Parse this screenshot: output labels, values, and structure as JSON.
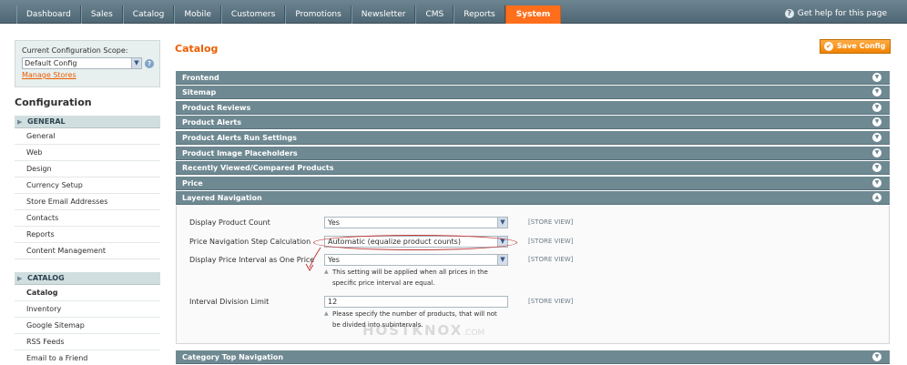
{
  "nav": {
    "items": [
      "Dashboard",
      "Sales",
      "Catalog",
      "Mobile",
      "Customers",
      "Promotions",
      "Newsletter",
      "CMS",
      "Reports",
      "System"
    ],
    "active": "System",
    "help_text": "Get help for this page"
  },
  "scope": {
    "label": "Current Configuration Scope:",
    "selected": "Default Config",
    "manage_link": "Manage Stores"
  },
  "sidebar": {
    "title": "Configuration",
    "groups": [
      {
        "label": "GENERAL",
        "items": [
          "General",
          "Web",
          "Design",
          "Currency Setup",
          "Store Email Addresses",
          "Contacts",
          "Reports",
          "Content Management"
        ]
      },
      {
        "label": "CATALOG",
        "items": [
          "Catalog",
          "Inventory",
          "Google Sitemap",
          "RSS Feeds",
          "Email to a Friend"
        ],
        "active": "Catalog"
      }
    ]
  },
  "main": {
    "title": "Catalog",
    "save_label": "Save Config",
    "sections": [
      "Frontend",
      "Sitemap",
      "Product Reviews",
      "Product Alerts",
      "Product Alerts Run Settings",
      "Product Image Placeholders",
      "Recently Viewed/Compared Products",
      "Price",
      "Layered Navigation",
      "Category Top Navigation"
    ],
    "expanded": "Layered Navigation",
    "fields": [
      {
        "label": "Display Product Count",
        "value": "Yes",
        "scope": "[STORE VIEW]"
      },
      {
        "label": "Price Navigation Step Calculation",
        "value": "Automatic (equalize product counts)",
        "scope": "[STORE VIEW]"
      },
      {
        "label": "Display Price Interval as One Price",
        "value": "Yes",
        "scope": "[STORE VIEW]",
        "note": "This setting will be applied when all prices in the specific price interval are equal."
      },
      {
        "label": "Interval Division Limit",
        "value": "12",
        "scope": "[STORE VIEW]",
        "note": "Please specify the number of products, that will not be divided into subintervals."
      }
    ]
  },
  "watermark": {
    "text": "HOSTKNOX",
    "suffix": ".COM"
  },
  "colors": {
    "accent": "#eb5e00",
    "nav_bg": "#5d7582",
    "section_bg": "#6f8992",
    "active_tab": "#ff6f1b"
  }
}
